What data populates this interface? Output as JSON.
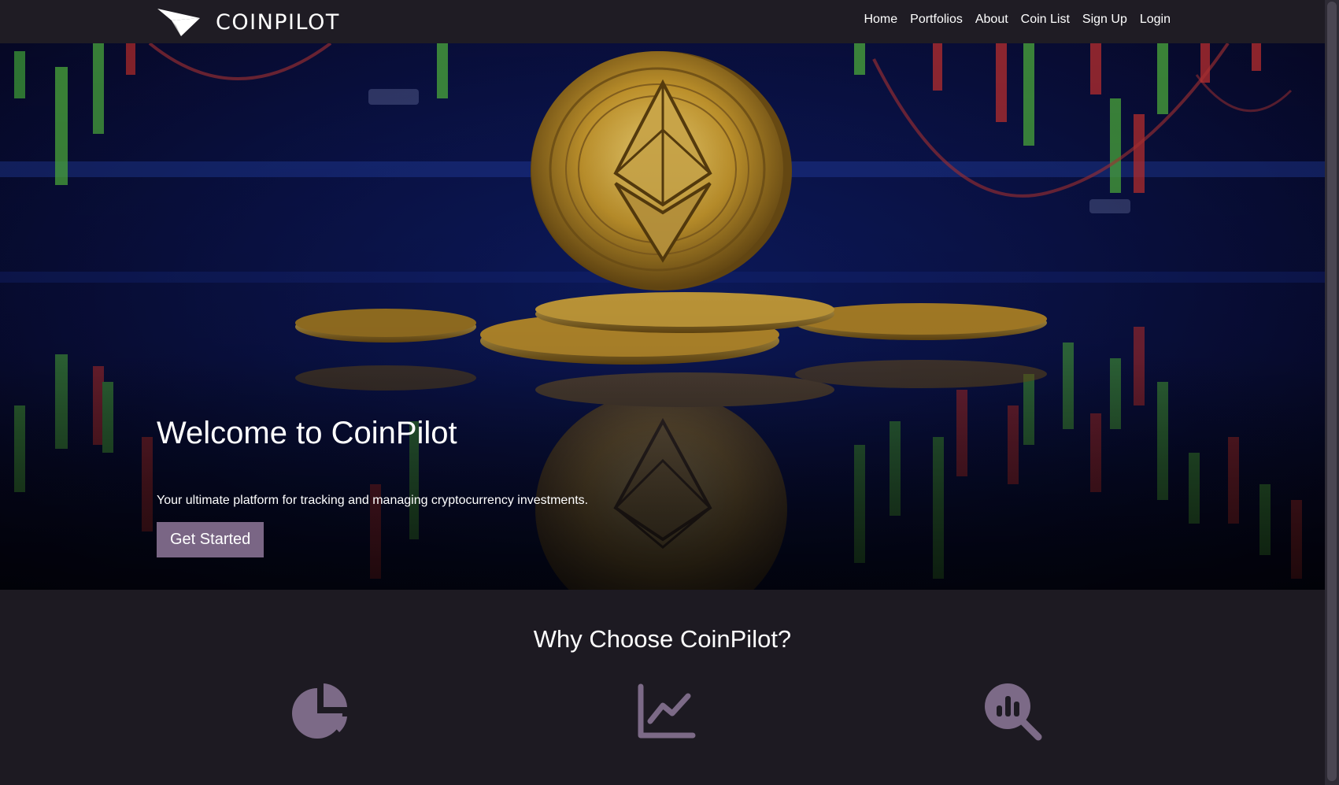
{
  "brand": {
    "name": "COINPILOT",
    "logo_icon": "paper-plane-icon"
  },
  "nav": {
    "links": [
      "Home",
      "Portfolios",
      "About",
      "Coin List",
      "Sign Up",
      "Login"
    ]
  },
  "hero": {
    "title": "Welcome to CoinPilot",
    "subtitle": "Your ultimate platform for tracking and managing cryptocurrency investments.",
    "cta_label": "Get Started",
    "background": "ethereum-coin-on-chart-image"
  },
  "why": {
    "title": "Why Choose CoinPilot?",
    "icons": [
      "pie-chart-icon",
      "line-chart-icon",
      "search-analytics-icon"
    ]
  },
  "colors": {
    "page_bg": "#1d1a22",
    "navbar_bg": "#1f1c24",
    "accent": "#7a6685",
    "icon": "#7c6a87"
  }
}
